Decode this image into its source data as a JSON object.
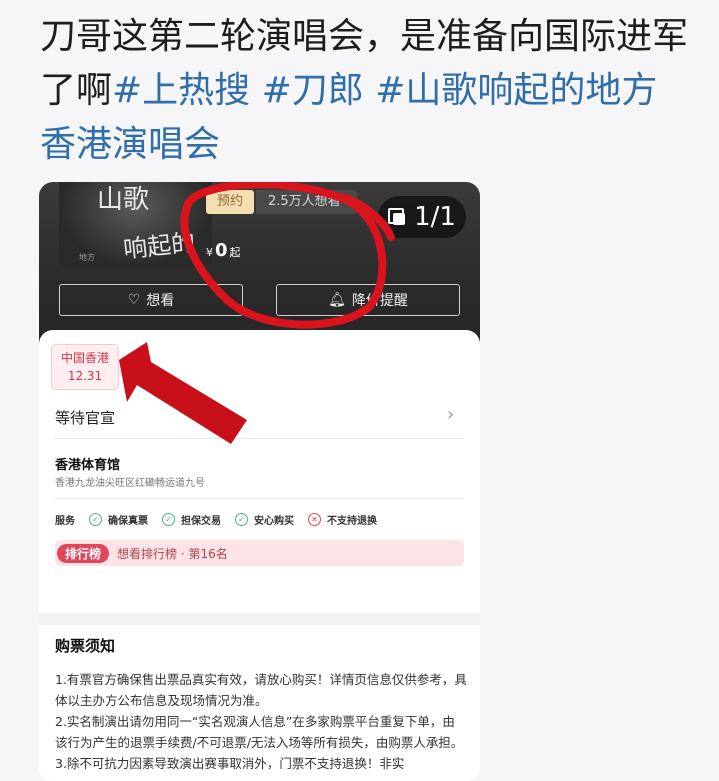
{
  "post": {
    "text": "刀哥这第二轮演唱会，是准备向国际进军了啊",
    "tags": [
      "#上热搜",
      "#刀郎",
      "#山歌响起的地方香港演唱会"
    ]
  },
  "screenshot": {
    "counter": "1/1",
    "poster": {
      "line1": "山歌",
      "line2": "响起的",
      "line3": "地方"
    },
    "chip_preorder": "预约",
    "chip_want": "2.5万人想看",
    "price_currency": "¥",
    "price_value": "0",
    "price_suffix": "起",
    "btn_want": "想看",
    "btn_alert": "降价提醒",
    "location": {
      "city": "中国香港",
      "date": "12.31"
    },
    "wait_label": "等待官宣",
    "venue": {
      "name": "香港体育馆",
      "address": "香港九龙油尖旺区红磡畅运道九号"
    },
    "services": {
      "label": "服务",
      "items": [
        "确保真票",
        "担保交易",
        "安心购买"
      ],
      "unsupported": "不支持退换"
    },
    "rank": {
      "pill": "排行榜",
      "text": "想看排行榜 · 第16名"
    },
    "notice": {
      "title": "购票须知",
      "lines": [
        "1.有票官方确保售出票品真实有效，请放心购买！详情页信息仅供参考，具体以主办方公布信息及现场情况为准。",
        "2.实名制演出请勿用同一“实名观演人信息”在多家购票平台重复下单，由该行为产生的退票手续费/不可退票/无法入场等所有损失，由购票人承担。",
        "3.除不可抗力因素导致演出赛事取消外，门票不支持退换！非实"
      ]
    }
  },
  "annotations": {
    "circle_color": "#d9141c",
    "arrow_color": "#c8101a"
  }
}
